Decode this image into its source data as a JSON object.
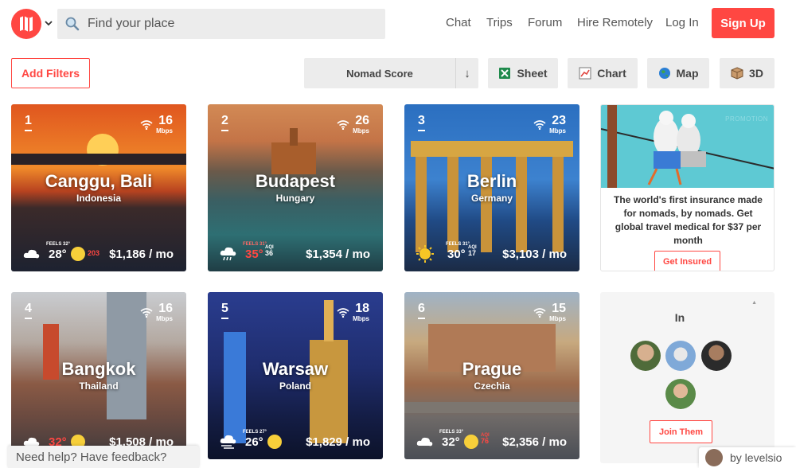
{
  "header": {
    "search_placeholder": "Find your place",
    "nav": [
      "Chat",
      "Trips",
      "Forum",
      "Hire Remotely",
      "Log In"
    ],
    "signup": "Sign Up"
  },
  "toolbar": {
    "add_filters": "Add Filters",
    "sort_label": "Nomad Score",
    "sort_arrow": "↓",
    "views": [
      "Sheet",
      "Chart",
      "Map",
      "3D"
    ]
  },
  "cities": [
    {
      "rank": "1",
      "speed": "16",
      "speed_unit": "Mbps",
      "city": "Canggu, Bali",
      "country": "Indonesia",
      "feels": "FEELS 32°",
      "temp": "28°",
      "weather": "partly-cloudy-icon",
      "aqi_label": "",
      "aqi": "203",
      "cost": "$1,186 / mo"
    },
    {
      "rank": "2",
      "speed": "26",
      "speed_unit": "Mbps",
      "city": "Budapest",
      "country": "Hungary",
      "feels": "FEELS 31°",
      "temp": "35°",
      "weather": "rain-cloud-icon",
      "aqi_label": "AQI",
      "aqi": "36",
      "cost": "$1,354 / mo"
    },
    {
      "rank": "3",
      "speed": "23",
      "speed_unit": "Mbps",
      "city": "Berlin",
      "country": "Germany",
      "feels": "FEELS 31°",
      "temp": "30°",
      "weather": "sun-icon",
      "aqi_label": "AQI",
      "aqi": "17",
      "cost": "$3,103 / mo"
    },
    {
      "rank": "4",
      "speed": "16",
      "speed_unit": "Mbps",
      "city": "Bangkok",
      "country": "Thailand",
      "feels": "",
      "temp": "32°",
      "weather": "partly-cloudy-icon",
      "aqi_label": "",
      "aqi": "",
      "cost": "$1,508 / mo"
    },
    {
      "rank": "5",
      "speed": "18",
      "speed_unit": "Mbps",
      "city": "Warsaw",
      "country": "Poland",
      "feels": "FEELS 27°",
      "temp": "26°",
      "weather": "cloud-wind-icon",
      "aqi_label": "",
      "aqi": "",
      "cost": "$1,829 / mo"
    },
    {
      "rank": "6",
      "speed": "15",
      "speed_unit": "Mbps",
      "city": "Prague",
      "country": "Czechia",
      "feels": "FEELS 33°",
      "temp": "32°",
      "weather": "partly-cloudy-icon",
      "aqi_label": "AQI",
      "aqi": "76",
      "cost": "$2,356 / mo"
    }
  ],
  "promo": {
    "tag": "PROMOTION",
    "text": "The world's first insurance made for nomads, by nomads. Get global travel medical for $37 per month",
    "button": "Get Insured"
  },
  "inbox": {
    "title": "In",
    "join": "Join Them"
  },
  "footer": {
    "help": "Need help? Have feedback?",
    "byline": "by levelsio"
  },
  "colors": {
    "accent": "#ff4742",
    "hot": "#ff4742"
  }
}
